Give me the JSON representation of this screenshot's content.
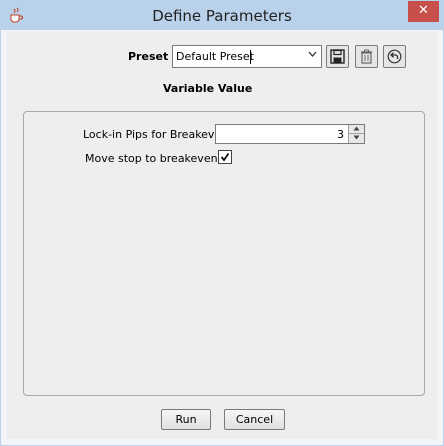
{
  "window": {
    "title": "Define Parameters",
    "close_glyph": "✕",
    "app_icon": "java-cup-icon"
  },
  "preset": {
    "label": "Preset",
    "selected": "Default Preset",
    "dropdown_icon": "chevron-down-icon",
    "buttons": {
      "save_icon": "save-icon",
      "delete_icon": "trash-icon",
      "revert_icon": "undo-icon"
    }
  },
  "section": {
    "header": "Variable Value"
  },
  "parameters": [
    {
      "label": "Lock-in Pips for Breakeven",
      "value": "3",
      "type": "spinner"
    },
    {
      "label": "Move stop to breakeven?",
      "checked": true,
      "type": "checkbox"
    }
  ],
  "footer": {
    "run_label": "Run",
    "cancel_label": "Cancel"
  },
  "colors": {
    "titlebar": "#b9d1ea",
    "close": "#c7504a",
    "client": "#eeeeee"
  }
}
